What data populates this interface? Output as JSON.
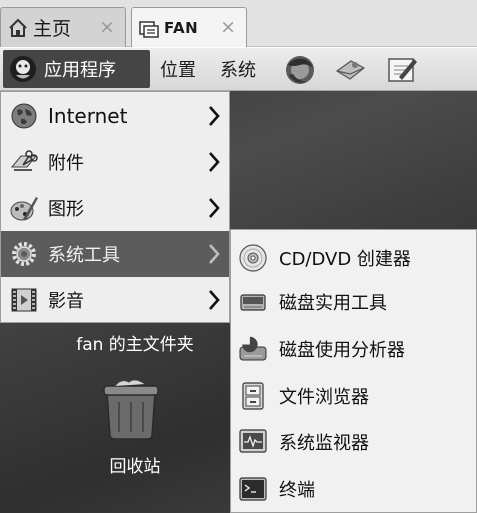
{
  "tabs": [
    {
      "label": "主页",
      "close": "×",
      "icon": "home-icon"
    },
    {
      "label": "FAN",
      "close": "×",
      "icon": "folder-icon"
    }
  ],
  "panel": {
    "applications": "应用程序",
    "places": "位置",
    "system": "系统"
  },
  "menu": {
    "items": [
      {
        "label": "Internet",
        "icon": "globe-icon"
      },
      {
        "label": "附件",
        "icon": "accessories-icon"
      },
      {
        "label": "图形",
        "icon": "graphics-icon"
      },
      {
        "label": "系统工具",
        "icon": "gear-icon"
      },
      {
        "label": "影音",
        "icon": "film-icon"
      }
    ],
    "active_index": 3
  },
  "submenu": {
    "items": [
      {
        "label": "CD/DVD 创建器",
        "icon": "disc-icon"
      },
      {
        "label": "磁盘实用工具",
        "icon": "disk-utility-icon"
      },
      {
        "label": "磁盘使用分析器",
        "icon": "disk-analyzer-icon"
      },
      {
        "label": "文件浏览器",
        "icon": "file-cabinet-icon"
      },
      {
        "label": "系统监视器",
        "icon": "system-monitor-icon"
      },
      {
        "label": "终端",
        "icon": "terminal-icon"
      }
    ]
  },
  "desktop": {
    "home_folder_label": "fan 的主文件夹",
    "trash_label": "回收站"
  }
}
